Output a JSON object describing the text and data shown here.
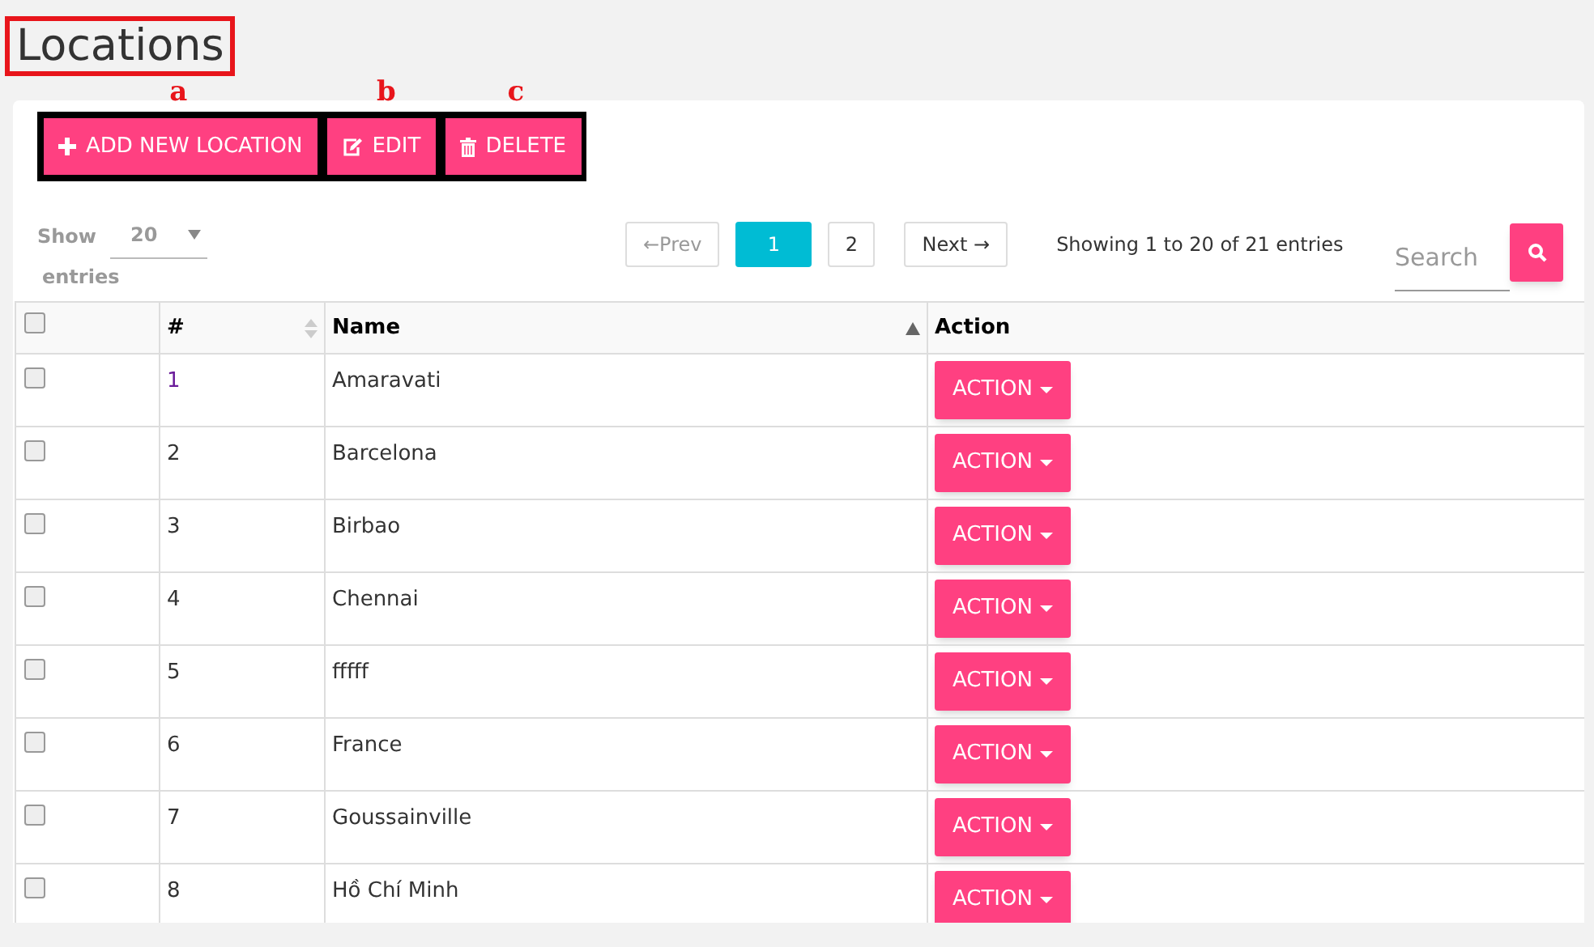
{
  "title": "Locations",
  "toolbar": {
    "buttons": [
      {
        "kind": "add",
        "label": "ADD NEW LOCATION",
        "annotation": "a"
      },
      {
        "kind": "edit",
        "label": "EDIT",
        "annotation": "b"
      },
      {
        "kind": "delete",
        "label": "DELETE",
        "annotation": "c"
      }
    ]
  },
  "length_menu": {
    "label_before": "Show",
    "value": "20",
    "label_after": "entries"
  },
  "pagination": {
    "prev": "←Prev",
    "pages": [
      {
        "label": "1",
        "selected": true
      },
      {
        "label": "2",
        "selected": false
      }
    ],
    "next": "Next →"
  },
  "info": "Showing 1 to 20 of 21 entries",
  "search": {
    "placeholder": "Search"
  },
  "table": {
    "select_all_checked": false,
    "columns": [
      "#",
      "Name",
      "Action"
    ],
    "rows": [
      {
        "checked": false,
        "number": "1",
        "visited": true,
        "name": "Amaravati",
        "action": "ACTION"
      },
      {
        "checked": false,
        "number": "2",
        "visited": false,
        "name": "Barcelona",
        "action": "ACTION"
      },
      {
        "checked": false,
        "number": "3",
        "visited": false,
        "name": "Birbao",
        "action": "ACTION"
      },
      {
        "checked": false,
        "number": "4",
        "visited": false,
        "name": "Chennai",
        "action": "ACTION"
      },
      {
        "checked": false,
        "number": "5",
        "visited": false,
        "name": "fffff",
        "action": "ACTION"
      },
      {
        "checked": false,
        "number": "6",
        "visited": false,
        "name": "France",
        "action": "ACTION"
      },
      {
        "checked": false,
        "number": "7",
        "visited": false,
        "name": "Goussainville",
        "action": "ACTION"
      },
      {
        "checked": false,
        "number": "8",
        "visited": false,
        "name": "Hồ Chí Minh",
        "action": "ACTION"
      }
    ]
  }
}
